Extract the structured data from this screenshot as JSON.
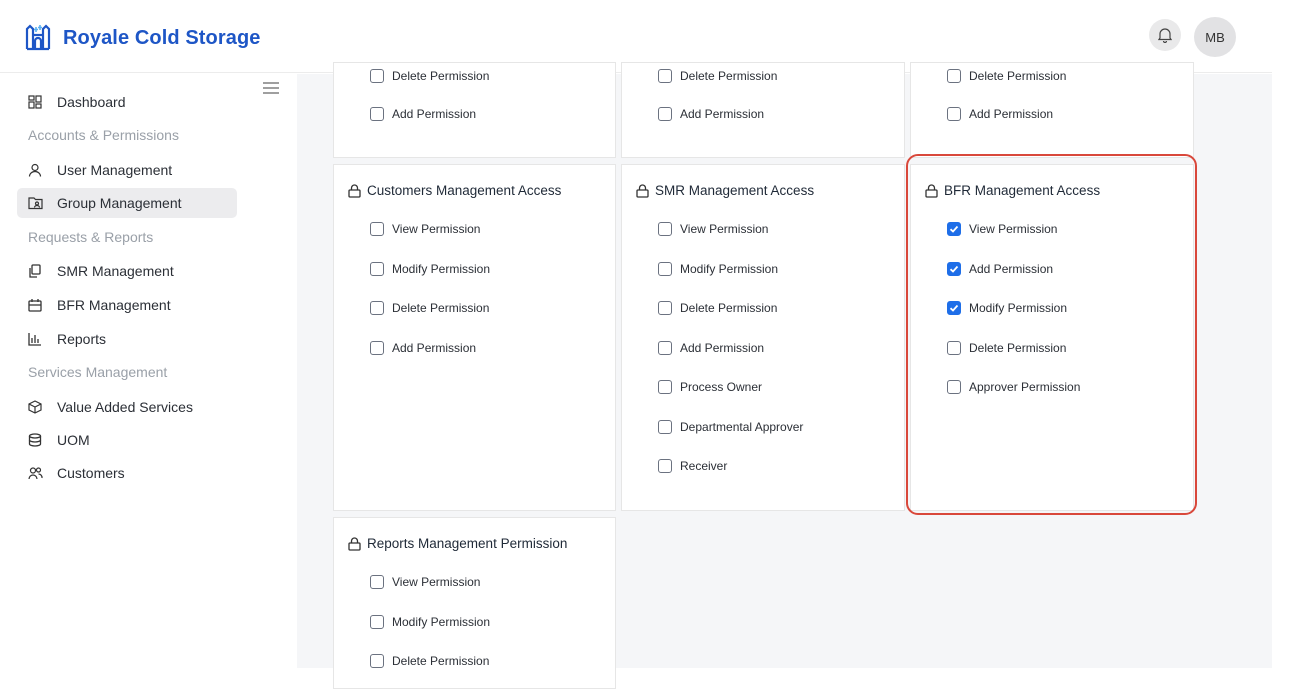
{
  "header": {
    "brand": "Royale Cold Storage",
    "avatar_initials": "MB",
    "brand_color": "#1e56c6"
  },
  "sidebar": {
    "dashboard": "Dashboard",
    "section_accounts": "Accounts & Permissions",
    "user_management": "User Management",
    "group_management": "Group Management",
    "section_requests": "Requests & Reports",
    "smr_management": "SMR Management",
    "bfr_management": "BFR Management",
    "reports": "Reports",
    "section_services": "Services Management",
    "value_added_services": "Value Added Services",
    "uom": "UOM",
    "customers": "Customers"
  },
  "top_cards": {
    "col1": [
      "Delete Permission",
      "Add Permission"
    ],
    "col2": [
      "Delete Permission",
      "Add Permission"
    ],
    "col3": [
      "Delete Permission",
      "Add Permission"
    ]
  },
  "customers_card": {
    "title": "Customers Management Access",
    "perms": [
      {
        "label": "View Permission",
        "checked": false
      },
      {
        "label": "Modify Permission",
        "checked": false
      },
      {
        "label": "Delete Permission",
        "checked": false
      },
      {
        "label": "Add Permission",
        "checked": false
      }
    ]
  },
  "smr_card": {
    "title": "SMR Management Access",
    "perms": [
      {
        "label": "View Permission",
        "checked": false
      },
      {
        "label": "Modify Permission",
        "checked": false
      },
      {
        "label": "Delete Permission",
        "checked": false
      },
      {
        "label": "Add Permission",
        "checked": false
      },
      {
        "label": "Process Owner",
        "checked": false
      },
      {
        "label": "Departmental Approver",
        "checked": false
      },
      {
        "label": "Receiver",
        "checked": false
      }
    ]
  },
  "bfr_card": {
    "title": "BFR Management Access",
    "perms": [
      {
        "label": "View Permission",
        "checked": true
      },
      {
        "label": "Add Permission",
        "checked": true
      },
      {
        "label": "Modify Permission",
        "checked": true
      },
      {
        "label": "Delete Permission",
        "checked": false
      },
      {
        "label": "Approver Permission",
        "checked": false
      }
    ]
  },
  "reports_card": {
    "title": "Reports Management Permission",
    "perms": [
      {
        "label": "View Permission",
        "checked": false
      },
      {
        "label": "Modify Permission",
        "checked": false
      },
      {
        "label": "Delete Permission",
        "checked": false
      }
    ]
  },
  "colors": {
    "checked": "#1e6ee8",
    "highlight": "#d9483b"
  }
}
